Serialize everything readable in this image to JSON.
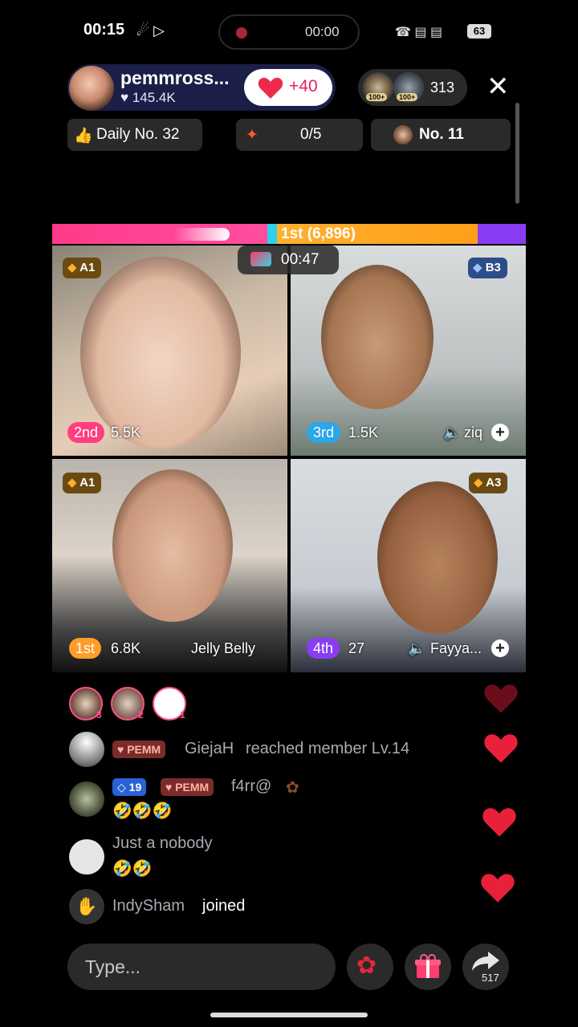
{
  "status_bar": {
    "time": "00:15",
    "record_time": "00:00",
    "battery": "63"
  },
  "host": {
    "name": "pemmross...",
    "likes": "145.4K",
    "like_increment": "+40",
    "viewer_badges": [
      "100+",
      "100+"
    ],
    "viewer_count": "313"
  },
  "rankings": {
    "daily": "Daily No. 32",
    "progress": "0/5",
    "rank": "No. 11"
  },
  "battle": {
    "leader": "1st (6,896)",
    "timer": "00:47",
    "colors": {
      "pink": "#ff3a8a",
      "cyan": "#2fd0e8",
      "orange": "#ffb02e",
      "purple": "#8a3cf2"
    }
  },
  "tiles": [
    {
      "level": "A1",
      "place": "2nd",
      "score": "5.5K",
      "name": ""
    },
    {
      "level": "B3",
      "place": "3rd",
      "score": "1.5K",
      "name": "ziq"
    },
    {
      "level": "A1",
      "place": "1st",
      "score": "6.8K",
      "name": "Jelly Belly"
    },
    {
      "level": "A3",
      "place": "4th",
      "score": "27",
      "name": "Fayya..."
    }
  ],
  "gifters": [
    "3",
    "2",
    "1"
  ],
  "chat": [
    {
      "badge": "PEMM",
      "user": "GiejaH",
      "text": "reached member Lv.14"
    },
    {
      "level": "19",
      "badge": "PEMM",
      "user": "f4rr@",
      "emoji": "🤣🤣🤣"
    },
    {
      "user": "Just a nobody",
      "emoji": "🤣🤣"
    },
    {
      "user": "IndySham",
      "text": "joined"
    }
  ],
  "input": {
    "placeholder": "Type..."
  },
  "share_count": "517",
  "icons": [
    "heart-icon",
    "close-icon",
    "thumbs-up-icon",
    "rose-icon",
    "gift-icon",
    "share-icon",
    "wave-icon",
    "mute-icon",
    "diamond-icon"
  ]
}
